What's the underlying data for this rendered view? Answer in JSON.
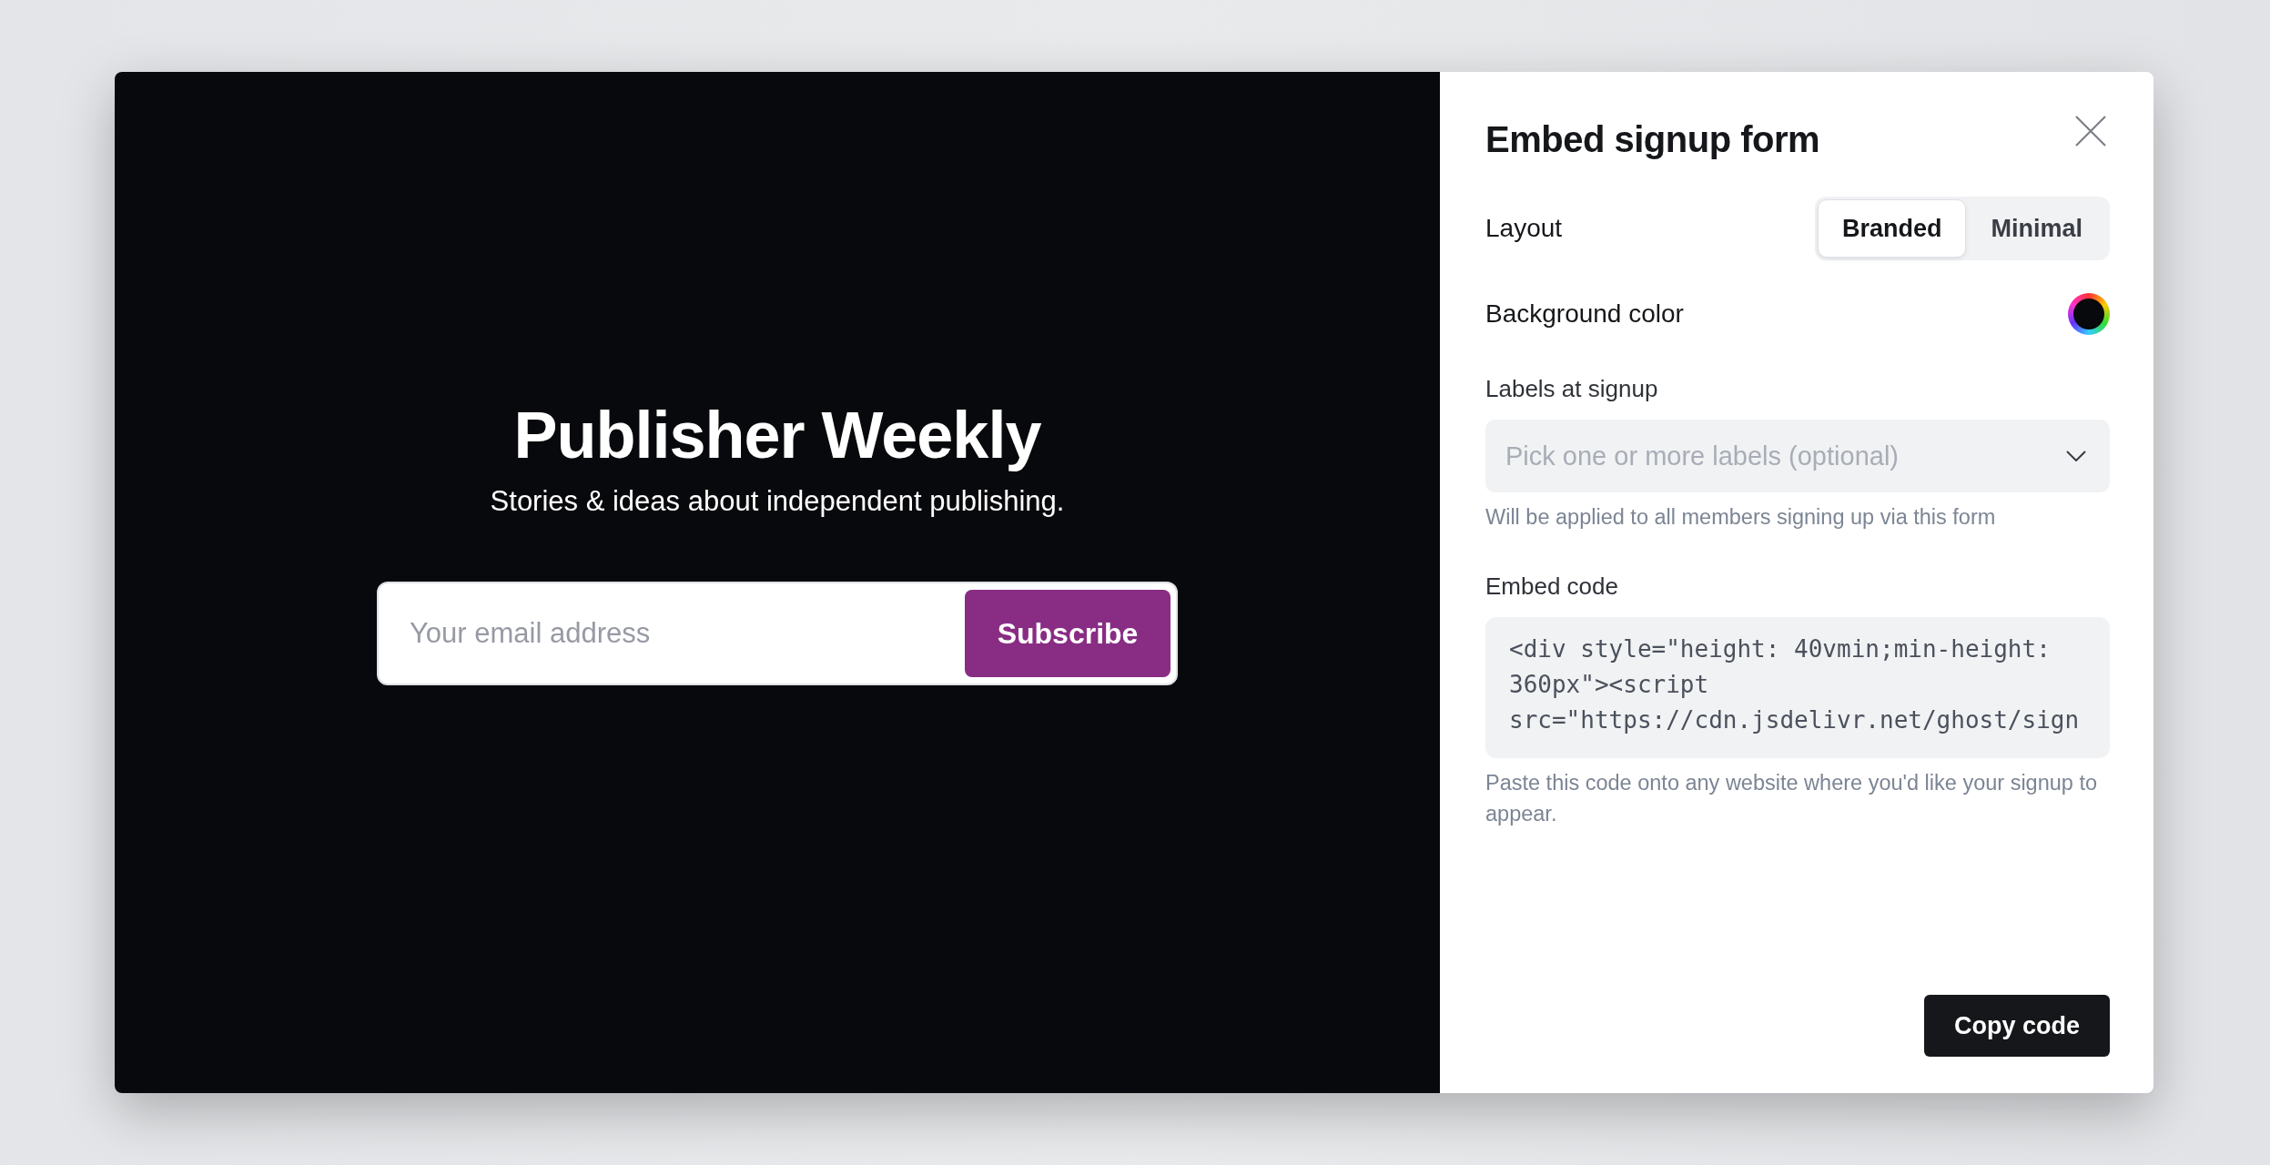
{
  "preview": {
    "title": "Publisher Weekly",
    "description": "Stories & ideas about independent publishing.",
    "email_placeholder": "Your email address",
    "subscribe_button": "Subscribe"
  },
  "panel": {
    "title": "Embed signup form",
    "layout": {
      "label": "Layout",
      "options": [
        {
          "label": "Branded",
          "selected": true
        },
        {
          "label": "Minimal",
          "selected": false
        }
      ]
    },
    "background_color": {
      "label": "Background color",
      "color": "#08090c"
    },
    "labels_at_signup": {
      "label": "Labels at signup",
      "placeholder": "Pick one or more labels (optional)",
      "hint": "Will be applied to all members signing up via this form"
    },
    "embed_code": {
      "label": "Embed code",
      "code": "<div style=\"height: 40vmin;min-height: 360px\"><script src=\"https://cdn.jsdelivr.net/ghost/sign",
      "hint": "Paste this code onto any website where you'd like your signup to appear."
    },
    "copy_button": "Copy code"
  }
}
